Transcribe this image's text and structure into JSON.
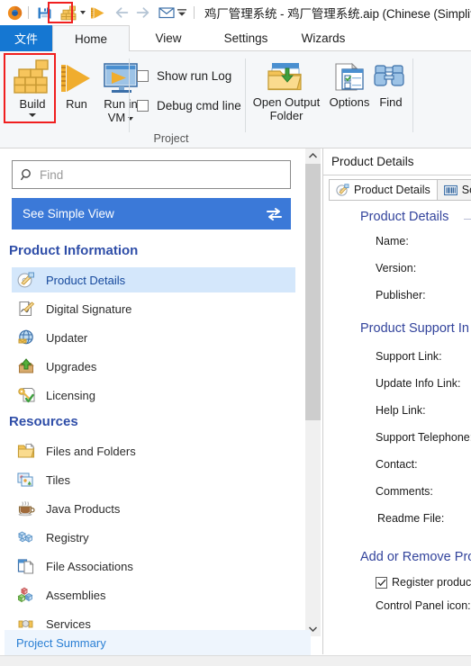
{
  "window": {
    "title": "鸡厂管理系统 - 鸡厂管理系统.aip (Chinese (Simplified) CN",
    "quick_access": [
      {
        "name": "app-logo-icon",
        "label": "Advanced Installer"
      },
      {
        "name": "save-icon",
        "label": "Save"
      },
      {
        "name": "build-icon",
        "label": "Build"
      },
      {
        "name": "build-dropdown-caret-icon",
        "label": "Build options"
      },
      {
        "name": "run-icon",
        "label": "Run"
      },
      {
        "name": "back-arrow-icon",
        "label": "Back"
      },
      {
        "name": "forward-arrow-icon",
        "label": "Forward"
      },
      {
        "name": "mail-icon",
        "label": "Send by email"
      },
      {
        "name": "quick-access-caret-icon",
        "label": "Customize Quick Access Toolbar"
      }
    ]
  },
  "ribbon": {
    "tabs": [
      {
        "label": "文件",
        "active": false,
        "is_file": true
      },
      {
        "label": "Home",
        "active": true,
        "is_file": false
      },
      {
        "label": "View",
        "active": false,
        "is_file": false
      },
      {
        "label": "Settings",
        "active": false,
        "is_file": false
      },
      {
        "label": "Wizards",
        "active": false,
        "is_file": false
      }
    ],
    "group_label": "Project",
    "buttons": {
      "build": "Build",
      "run": "Run",
      "run_in_vm_line1": "Run in",
      "run_in_vm_line2": "VM",
      "open_output_folder_line1": "Open Output",
      "open_output_folder_line2": "Folder",
      "options": "Options",
      "find": "Find"
    },
    "checkboxes": [
      {
        "label": "Show run Log",
        "checked": false
      },
      {
        "label": "Debug cmd line",
        "checked": false
      }
    ]
  },
  "left_panel": {
    "search": {
      "placeholder": "Find",
      "value": ""
    },
    "simple_view_button": {
      "label": "See Simple View",
      "icon": "swap-arrows-icon"
    },
    "sections": [
      {
        "heading": "Product Information",
        "items": [
          {
            "label": "Product Details",
            "icon": "product-details-icon",
            "selected": true
          },
          {
            "label": "Digital Signature",
            "icon": "digital-signature-icon",
            "selected": false
          },
          {
            "label": "Updater",
            "icon": "updater-icon",
            "selected": false
          },
          {
            "label": "Upgrades",
            "icon": "upgrades-icon",
            "selected": false
          },
          {
            "label": "Licensing",
            "icon": "licensing-icon",
            "selected": false
          }
        ]
      },
      {
        "heading": "Resources",
        "items": [
          {
            "label": "Files and Folders",
            "icon": "folder-icon",
            "selected": false
          },
          {
            "label": "Tiles",
            "icon": "tiles-icon",
            "selected": false
          },
          {
            "label": "Java Products",
            "icon": "java-coffee-icon",
            "selected": false
          },
          {
            "label": "Registry",
            "icon": "registry-blocks-icon",
            "selected": false
          },
          {
            "label": "File Associations",
            "icon": "file-associations-icon",
            "selected": false
          },
          {
            "label": "Assemblies",
            "icon": "assemblies-icon",
            "selected": false
          },
          {
            "label": "Services",
            "icon": "services-icon",
            "selected": false
          }
        ]
      }
    ],
    "project_summary": {
      "label": "Project Summary"
    },
    "scrollbar": {
      "up_arrow": "︿",
      "down_arrow": "﹀"
    }
  },
  "right_panel": {
    "header": "Product Details",
    "tabs": [
      {
        "label": "Product Details",
        "icon": "product-details-icon",
        "active": true
      },
      {
        "label": "Softw",
        "icon": "barcode-icon",
        "active": false
      }
    ],
    "groups": [
      {
        "heading": "Product Details",
        "fields": [
          {
            "label": "Name:"
          },
          {
            "label": "Version:"
          },
          {
            "label": "Publisher:"
          }
        ]
      },
      {
        "heading": "Product Support In",
        "fields": [
          {
            "label": "Support Link:"
          },
          {
            "label": "Update Info Link:"
          },
          {
            "label": "Help Link:"
          },
          {
            "label": "Support Telephone:"
          },
          {
            "label": "Contact:"
          },
          {
            "label": "Comments:"
          },
          {
            "label": "Readme File:"
          }
        ]
      },
      {
        "heading": "Add or Remove Pro",
        "fields": [
          {
            "label": "Control Panel icon:"
          }
        ],
        "checkbox": {
          "label": "Register product wit",
          "checked": true
        }
      }
    ]
  },
  "colors": {
    "file_tab_blue": "#1577d2",
    "simple_view_blue": "#3b79d8",
    "section_heading": "#2f4ea8",
    "form_heading": "#33449c",
    "selection_blue": "#d4e7fb",
    "highlight_red": "#f01f1f",
    "link_blue": "#2a7fd4"
  }
}
